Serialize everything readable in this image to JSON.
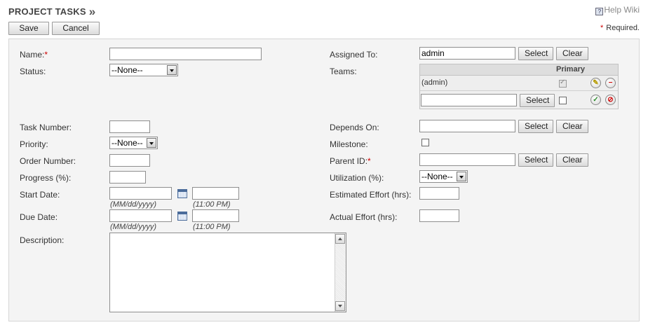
{
  "header": {
    "title": "PROJECT TASKS",
    "title_chevron": "»",
    "help_link": "Help Wiki",
    "save": "Save",
    "cancel": "Cancel",
    "required_star": "*",
    "required_note": "Required."
  },
  "form": {
    "name_label": "Name:",
    "status_label": "Status:",
    "status_value": "--None--",
    "task_number_label": "Task Number:",
    "priority_label": "Priority:",
    "priority_value": "--None--",
    "order_number_label": "Order Number:",
    "progress_label": "Progress (%):",
    "start_date_label": "Start Date:",
    "due_date_label": "Due Date:",
    "date_hint": "(MM/dd/yyyy)",
    "time_hint": "(11:00 PM)",
    "description_label": "Description:",
    "assigned_to_label": "Assigned To:",
    "assigned_to_value": "admin",
    "teams_label": "Teams:",
    "teams_primary_header": "Primary",
    "teams_row_name": "(admin)",
    "depends_on_label": "Depends On:",
    "milestone_label": "Milestone:",
    "parent_id_label": "Parent ID:",
    "utilization_label": "Utilization (%):",
    "utilization_value": "--None--",
    "estimated_effort_label": "Estimated Effort (hrs):",
    "actual_effort_label": "Actual Effort (hrs):",
    "select_btn": "Select",
    "clear_btn": "Clear"
  },
  "colors": {
    "required_star": "#cc0000",
    "panel_bg": "#f4f4f4"
  }
}
